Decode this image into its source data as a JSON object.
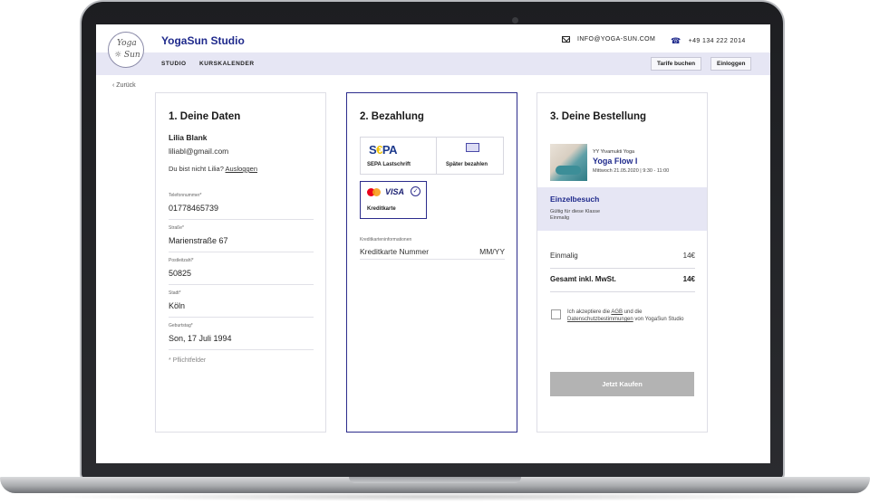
{
  "header": {
    "logo_line1": "Yoga",
    "logo_line2": "☼ Sun",
    "brand": "YogaSun Studio",
    "email": "INFO@YOGA-SUN.COM",
    "phone": "+49 134 222 2014"
  },
  "nav": {
    "items": [
      "STUDIO",
      "KURSKALENDER"
    ],
    "tarife_label": "Tarife buchen",
    "login_label": "Einloggen"
  },
  "back_label": "‹  Zurück",
  "step1": {
    "title": "1. Deine Daten",
    "name": "Lilia Blank",
    "email": "liliabl@gmail.com",
    "not_you": "Du bist nicht Lilia?",
    "logout": "Ausloggen",
    "fields": [
      {
        "label": "Telefonnummer*",
        "value": "01778465739"
      },
      {
        "label": "Straße*",
        "value": "Marienstraße 67"
      },
      {
        "label": "Postleitzahl*",
        "value": "50825"
      },
      {
        "label": "Stadt*",
        "value": "Köln"
      },
      {
        "label": "Geburtstag*",
        "value": "Son, 17 Juli 1994"
      }
    ],
    "required_note": "* Pflichtfelder"
  },
  "step2": {
    "title": "2. Bezahlung",
    "options": [
      {
        "label": "SEPA Lastschrift",
        "logo": "SEPA"
      },
      {
        "label": "Später bezahlen",
        "icon": "bill-icon"
      },
      {
        "label": "Kreditkarte",
        "logo": "VISA",
        "selected": true
      }
    ],
    "cc_info_label": "Kreditkarteninformationen",
    "cc_number_placeholder": "Kreditkarte Nummer",
    "cc_expiry_placeholder": "MM/YY"
  },
  "step3": {
    "title": "3. Deine Bestellung",
    "product_subtitle": "YY Yivamukti Yoga",
    "product_title": "Yoga Flow I",
    "product_date": "Mittwoch 21.05.2020 | 9:30 - 11:00",
    "ticket_title": "Einzelbesuch",
    "ticket_line1": "Gültig für diese Klasse",
    "ticket_line2": "Einmalig",
    "line_label": "Einmalig",
    "line_price": "14€",
    "total_label": "Gesamt inkl. MwSt.",
    "total_price": "14€",
    "agb_pre": "Ich akzeptiere die",
    "agb_link": "AGB",
    "agb_mid": "und die",
    "privacy_link": "Datenschutzbestimmungen",
    "agb_post": "von YogaSun Studio",
    "buy_label": "Jetzt Kaufen"
  },
  "colors": {
    "accent": "#1f2a8c",
    "nav_bg": "#e6e6f4",
    "button_disabled": "#b3b3b3"
  }
}
